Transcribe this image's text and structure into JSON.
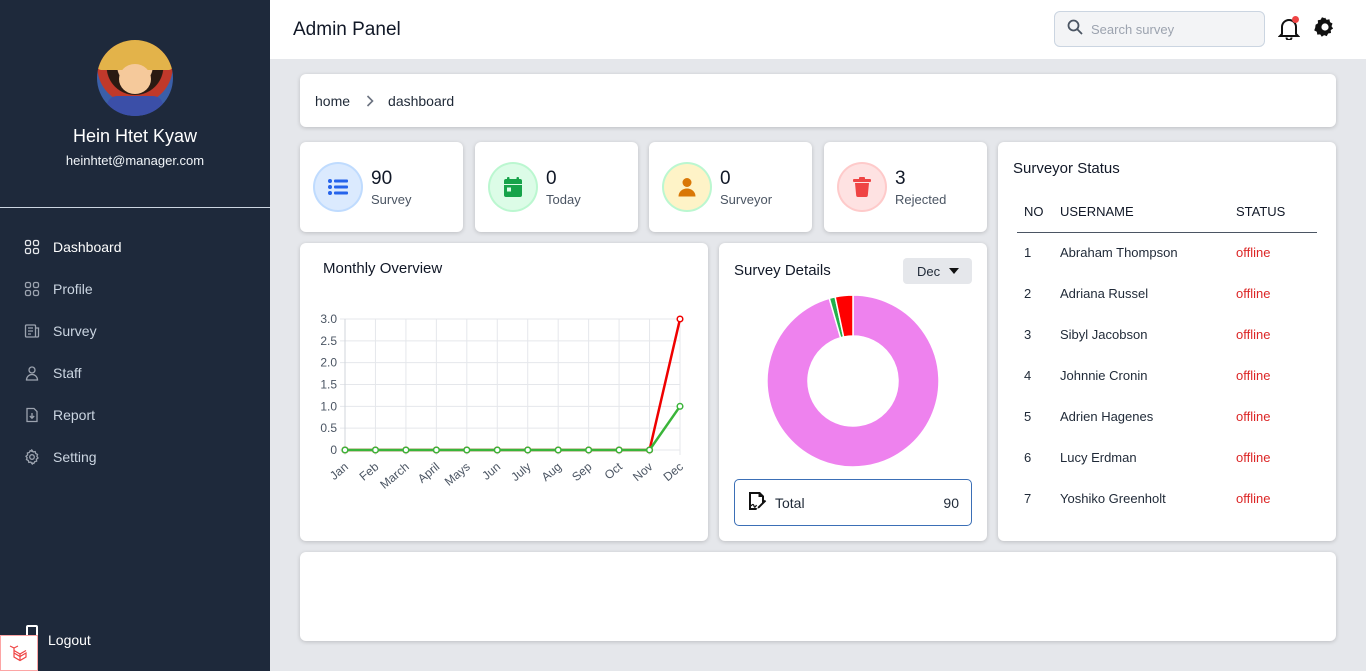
{
  "header": {
    "title": "Admin Panel",
    "search_placeholder": "Search survey"
  },
  "user": {
    "name": "Hein Htet Kyaw",
    "email": "heinhtet@manager.com"
  },
  "sidebar": {
    "items": [
      {
        "label": "Dashboard",
        "icon": "grid-icon"
      },
      {
        "label": "Profile",
        "icon": "grid-icon"
      },
      {
        "label": "Survey",
        "icon": "document-icon"
      },
      {
        "label": "Staff",
        "icon": "user-icon"
      },
      {
        "label": "Report",
        "icon": "report-icon"
      },
      {
        "label": "Setting",
        "icon": "gear-icon"
      }
    ],
    "logout_label": "Logout"
  },
  "breadcrumb": {
    "home": "home",
    "current": "dashboard"
  },
  "stats": [
    {
      "value": "90",
      "label": "Survey",
      "color": "#3b82f6"
    },
    {
      "value": "0",
      "label": "Today",
      "color": "#16a34a"
    },
    {
      "value": "0",
      "label": "Surveyor",
      "color": "#d97706"
    },
    {
      "value": "3",
      "label": "Rejected",
      "color": "#ef4444"
    }
  ],
  "monthly": {
    "title": "Monthly Overview"
  },
  "chart_data": [
    {
      "type": "line",
      "categories": [
        "Jan",
        "Feb",
        "March",
        "April",
        "Mays",
        "Jun",
        "July",
        "Aug",
        "Sep",
        "Oct",
        "Nov",
        "Dec"
      ],
      "series": [
        {
          "color": "#ef0000",
          "values": [
            0,
            0,
            0,
            0,
            0,
            0,
            0,
            0,
            0,
            0,
            0,
            3
          ]
        },
        {
          "color": "#3ab53a",
          "values": [
            0,
            0,
            0,
            0,
            0,
            0,
            0,
            0,
            0,
            0,
            0,
            1
          ]
        }
      ],
      "yticks": [
        "0",
        "0.5",
        "1.0",
        "1.5",
        "2.0",
        "2.5",
        "3.0"
      ],
      "ylim": [
        0,
        3
      ],
      "grid": true
    },
    {
      "type": "pie",
      "categories": [
        "",
        "",
        ""
      ],
      "values": [
        86,
        1,
        3
      ],
      "colors": [
        "#ee82ee",
        "#22b14c",
        "#ff0000"
      ]
    }
  ],
  "survey_details": {
    "title": "Survey Details",
    "month": "Dec",
    "total_label": "Total",
    "total_value": "90"
  },
  "surveyor_status": {
    "title": "Surveyor Status",
    "columns": [
      "NO",
      "USERNAME",
      "STATUS"
    ],
    "rows": [
      {
        "no": "1",
        "username": "Abraham Thompson",
        "status": "offline"
      },
      {
        "no": "2",
        "username": "Adriana Russel",
        "status": "offline"
      },
      {
        "no": "3",
        "username": "Sibyl Jacobson",
        "status": "offline"
      },
      {
        "no": "4",
        "username": "Johnnie Cronin",
        "status": "offline"
      },
      {
        "no": "5",
        "username": "Adrien Hagenes",
        "status": "offline"
      },
      {
        "no": "6",
        "username": "Lucy Erdman",
        "status": "offline"
      },
      {
        "no": "7",
        "username": "Yoshiko Greenholt",
        "status": "offline"
      }
    ]
  }
}
